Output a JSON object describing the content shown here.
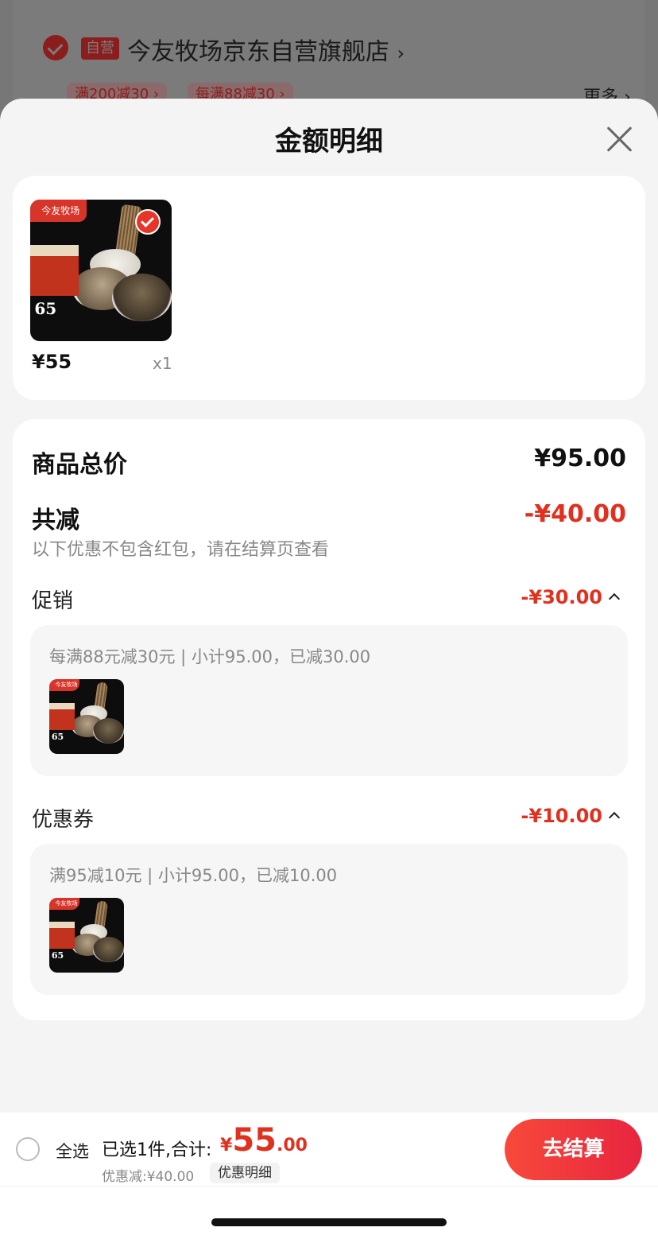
{
  "background": {
    "store_tag": "自营",
    "store_name": "今友牧场京东自营旗舰店",
    "store_chevron": "›",
    "chips": [
      "满200减30 ›",
      "每满88减30 ›"
    ],
    "more": "更多 ›"
  },
  "sheet": {
    "title": "金额明细",
    "close_icon": "close-icon"
  },
  "product": {
    "brand": "今友牧场",
    "thumb_price": "65",
    "price": "¥55",
    "qty": "x1",
    "selected": true
  },
  "summary": {
    "total_label": "商品总价",
    "total_value": "¥95.00",
    "reduce_label": "共减",
    "reduce_value": "-¥40.00",
    "note": "以下优惠不包含红包，请在结算页查看",
    "promo": {
      "label": "促销",
      "value": "-¥30.00",
      "detail": "每满88元减30元 | 小计95.00，已减30.00"
    },
    "coupon": {
      "label": "优惠券",
      "value": "-¥10.00",
      "detail": "满95减10元 | 小计95.00，已减10.00"
    }
  },
  "bottom": {
    "select_all": "全选",
    "selected_text": "已选1件,合计:",
    "currency": "¥",
    "total_int": "55",
    "total_dec": ".00",
    "discount": "优惠减:¥40.00",
    "detail_link": "优惠明细",
    "checkout": "去结算"
  },
  "colors": {
    "accent_red": "#e0301e",
    "checkout_gradient_start": "#f74a3a",
    "checkout_gradient_end": "#e8243f"
  }
}
